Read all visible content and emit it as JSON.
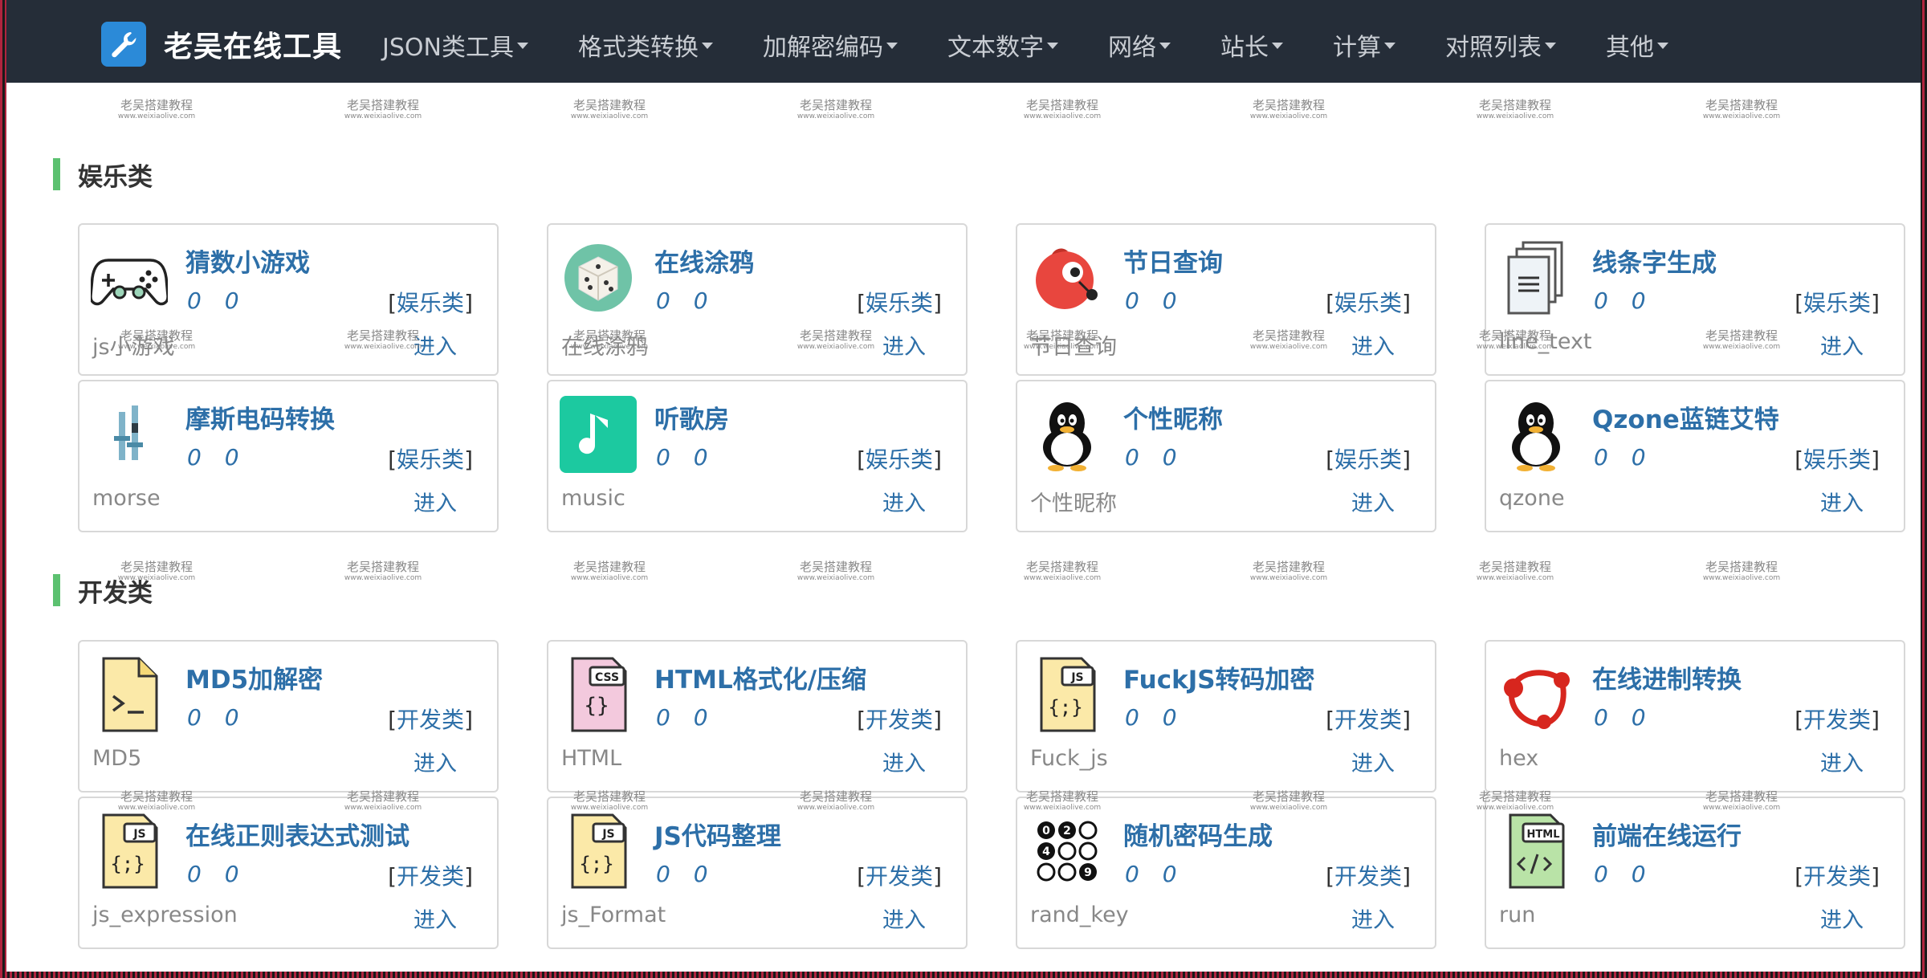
{
  "navbar": {
    "brand_title": "老吴在线工具",
    "brand_icon": "wrench-icon",
    "items": [
      {
        "label": "JSON类工具"
      },
      {
        "label": "格式类转换"
      },
      {
        "label": "加解密编码"
      },
      {
        "label": "文本数字"
      },
      {
        "label": "网络"
      },
      {
        "label": "站长"
      },
      {
        "label": "计算"
      },
      {
        "label": "对照列表"
      },
      {
        "label": "其他"
      }
    ]
  },
  "watermark": {
    "line1": "老吴搭建教程",
    "line2": "www.weixiaolive.com"
  },
  "sections": [
    {
      "title": "娱乐类",
      "cards": [
        {
          "title": "猜数小游戏",
          "stats": "0 0",
          "category": "娱乐类",
          "slug": "js小游戏",
          "enter": "进入",
          "icon": "gamepad-icon"
        },
        {
          "title": "在线涂鸦",
          "stats": "0 0",
          "category": "娱乐类",
          "slug": "在线涂鸦",
          "enter": "进入",
          "icon": "dice-icon"
        },
        {
          "title": "节日查询",
          "stats": "0 0",
          "category": "娱乐类",
          "slug": "节日查询",
          "enter": "进入",
          "icon": "bird-icon"
        },
        {
          "title": "线条字生成",
          "stats": "0 0",
          "category": "娱乐类",
          "slug": "line_text",
          "enter": "进入",
          "icon": "documents-icon"
        },
        {
          "title": "摩斯电码转换",
          "stats": "0 0",
          "category": "娱乐类",
          "slug": "morse",
          "enter": "进入",
          "icon": "equalizer-icon"
        },
        {
          "title": "听歌房",
          "stats": "0 0",
          "category": "娱乐类",
          "slug": "music",
          "enter": "进入",
          "icon": "music-note-icon"
        },
        {
          "title": "个性昵称",
          "stats": "0 0",
          "category": "娱乐类",
          "slug": "个性昵称",
          "enter": "进入",
          "icon": "penguin-icon"
        },
        {
          "title": "Qzone蓝链艾特",
          "stats": "0 0",
          "category": "娱乐类",
          "slug": "qzone",
          "enter": "进入",
          "icon": "penguin-icon"
        }
      ]
    },
    {
      "title": "开发类",
      "cards": [
        {
          "title": "MD5加解密",
          "stats": "0 0",
          "category": "开发类",
          "slug": "MD5",
          "enter": "进入",
          "icon": "terminal-file-icon"
        },
        {
          "title": "HTML格式化/压缩",
          "stats": "0 0",
          "category": "开发类",
          "slug": "HTML",
          "enter": "进入",
          "icon": "css-file-icon"
        },
        {
          "title": "FuckJS转码加密",
          "stats": "0 0",
          "category": "开发类",
          "slug": "Fuck_js",
          "enter": "进入",
          "icon": "js-file-icon"
        },
        {
          "title": "在线进制转换",
          "stats": "0 0",
          "category": "开发类",
          "slug": "hex",
          "enter": "进入",
          "icon": "share-nodes-icon"
        },
        {
          "title": "在线正则表达式测试",
          "stats": "0 0",
          "category": "开发类",
          "slug": "js_expression",
          "enter": "进入",
          "icon": "js-file-icon"
        },
        {
          "title": "JS代码整理",
          "stats": "0 0",
          "category": "开发类",
          "slug": "js_Format",
          "enter": "进入",
          "icon": "js-file-icon"
        },
        {
          "title": "随机密码生成",
          "stats": "0 0",
          "category": "开发类",
          "slug": "rand_key",
          "enter": "进入",
          "icon": "number-dots-icon"
        },
        {
          "title": "前端在线运行",
          "stats": "0 0",
          "category": "开发类",
          "slug": "run",
          "enter": "进入",
          "icon": "html-file-icon"
        }
      ]
    }
  ]
}
